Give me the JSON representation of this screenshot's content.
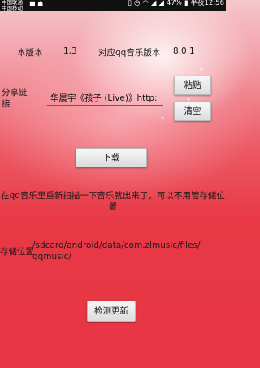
{
  "statusbar": {
    "carrier_line1": "中国联通",
    "carrier_line2": "中国移动",
    "battery_percent": "47%",
    "time": "半夜12:56"
  },
  "version_row": {
    "app_version_label": "本版本",
    "app_version_value": "1.3",
    "qq_version_label": "对应qq音乐版本",
    "qq_version_value": "8.0.1"
  },
  "share": {
    "label": "分享链接",
    "value": "华晨宇《孩子 (Live)》http:",
    "paste_button": "粘贴",
    "clear_button": "清空"
  },
  "download_button": "下载",
  "rescan_hint": "在qq音乐里重新扫描一下音乐就出来了，可以不用管存储位置",
  "storage": {
    "label": "存储位置",
    "path": "/sdcard/android/data/com.zlmusic/files/qqmusic/"
  },
  "check_update_button": "检测更新"
}
